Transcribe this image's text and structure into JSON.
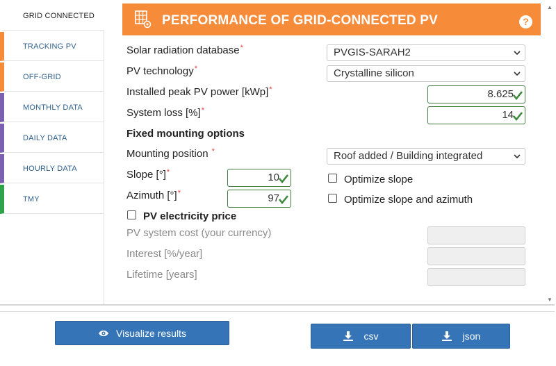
{
  "sidebar": {
    "items": [
      {
        "label": "GRID CONNECTED",
        "color": "#ffffff"
      },
      {
        "label": "TRACKING PV",
        "color": "#f68b3a"
      },
      {
        "label": "OFF-GRID",
        "color": "#f68b3a"
      },
      {
        "label": "MONTHLY DATA",
        "color": "#7c5fb0"
      },
      {
        "label": "DAILY DATA",
        "color": "#7c5fb0"
      },
      {
        "label": "HOURLY DATA",
        "color": "#7c5fb0"
      },
      {
        "label": "TMY",
        "color": "#2fa34a"
      }
    ]
  },
  "header": {
    "title": "PERFORMANCE OF GRID-CONNECTED PV",
    "icon": "solar-panel-icon",
    "help_icon": "question-icon",
    "color": "#f68b3a"
  },
  "form": {
    "radiation_db": {
      "label": "Solar radiation database",
      "value": "PVGIS-SARAH2"
    },
    "pv_tech": {
      "label": "PV technology",
      "value": "Crystalline silicon"
    },
    "peak_power": {
      "label": "Installed peak PV power [kWp]",
      "value": "8.625"
    },
    "system_loss": {
      "label": "System loss [%]",
      "value": "14"
    },
    "fixed_heading": "Fixed mounting options",
    "mounting": {
      "label": "Mounting position",
      "value": "Roof added / Building integrated"
    },
    "slope": {
      "label": "Slope [°]",
      "value": "10"
    },
    "azimuth": {
      "label": "Azimuth [°]",
      "value": "97"
    },
    "optimize_slope": "Optimize slope",
    "optimize_both": "Optimize slope and azimuth",
    "price_heading": "PV electricity price",
    "system_cost": "PV system cost (your currency)",
    "interest": "Interest [%/year]",
    "lifetime": "Lifetime [years]",
    "required_mark": "*"
  },
  "buttons": {
    "visualize": "Visualize results",
    "csv": "csv",
    "json": "json"
  },
  "colors": {
    "button": "#3574b7",
    "valid": "#3f7a3f"
  }
}
